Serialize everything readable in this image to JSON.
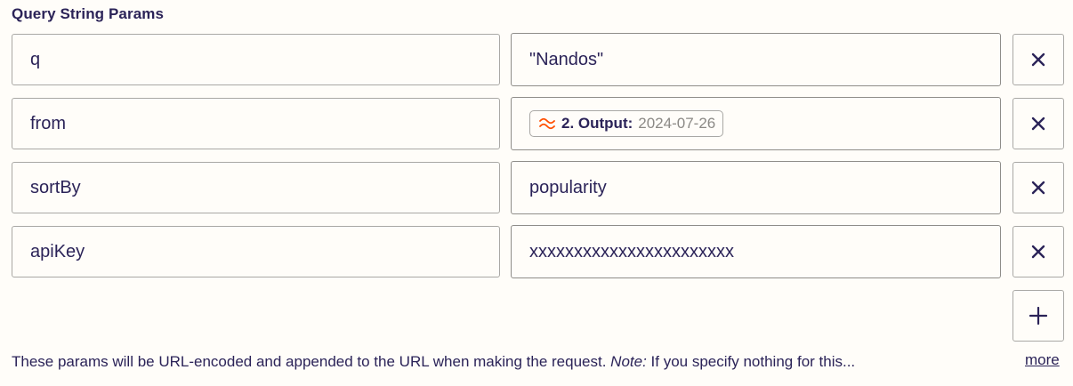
{
  "section": {
    "title": "Query String Params"
  },
  "params": [
    {
      "key": "q",
      "value": "\"Nandos\""
    },
    {
      "key": "from",
      "value_pill": {
        "step": "2. Output:",
        "value": "2024-07-26"
      }
    },
    {
      "key": "sortBy",
      "value": "popularity"
    },
    {
      "key": "apiKey",
      "value": "xxxxxxxxxxxxxxxxxxxxxxx"
    }
  ],
  "icons": {
    "remove": "close-icon",
    "add": "plus-icon",
    "step": "step-output-icon"
  },
  "colors": {
    "accent": "#ff4f00",
    "text": "#2b2358",
    "muted": "#8b8985",
    "border": "#a9a8a5",
    "background": "#fffdf9"
  },
  "help": {
    "text": "These params will be URL-encoded and appended to the URL when making the request. ",
    "note_label": "Note:",
    "note_text": " If you specify nothing for this...",
    "more_label": "more"
  }
}
